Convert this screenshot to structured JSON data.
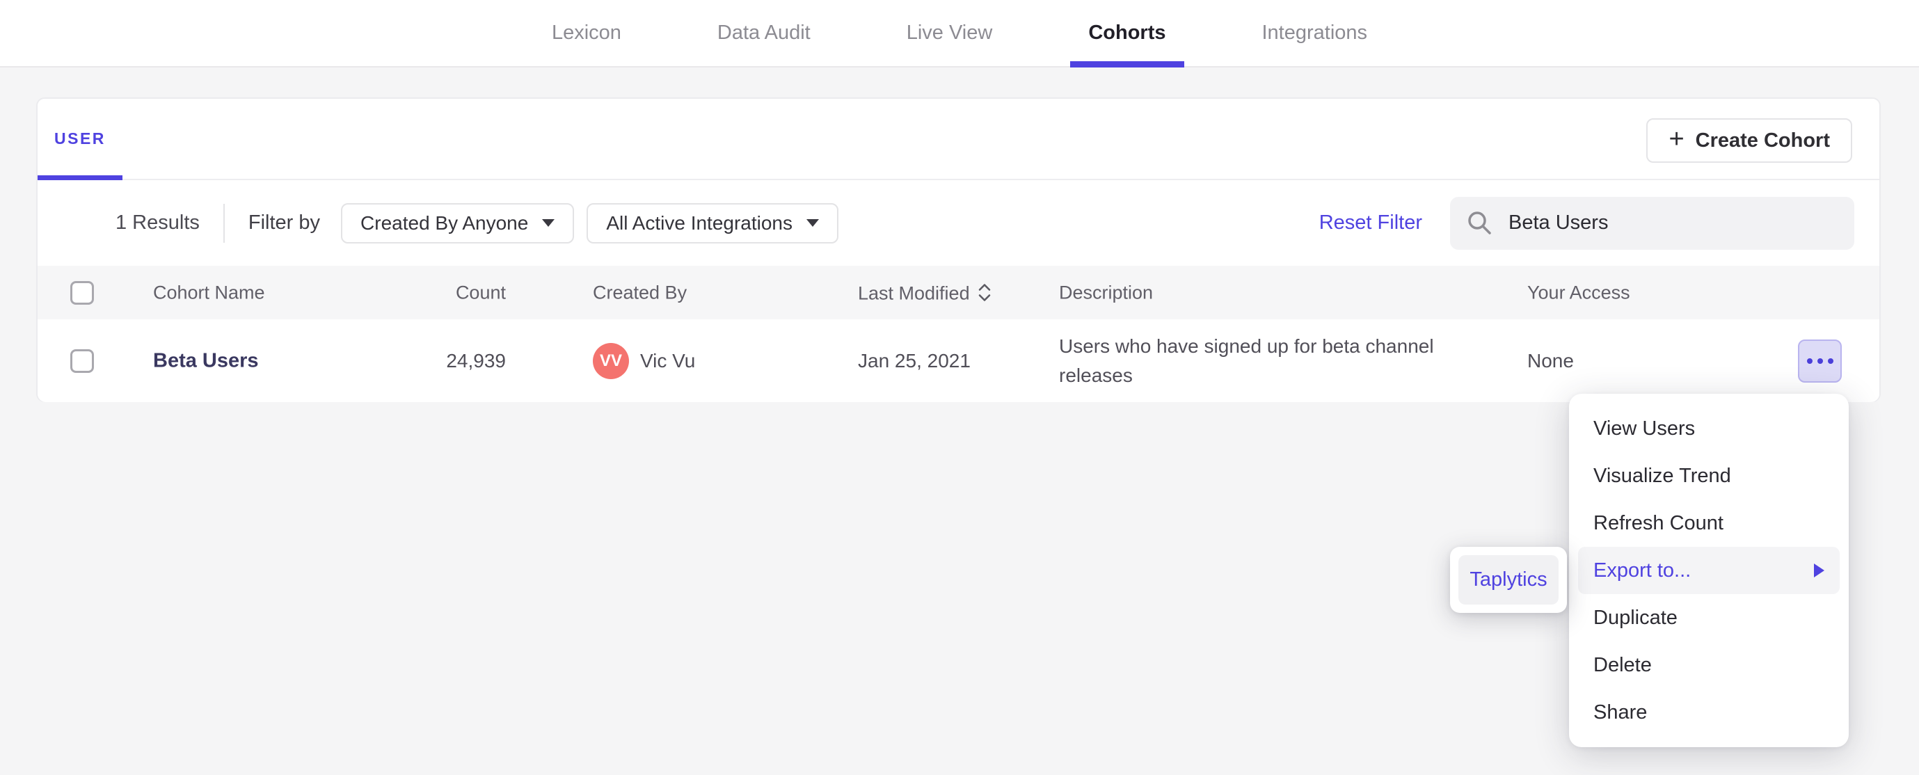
{
  "topnav": {
    "tabs": [
      {
        "label": "Lexicon",
        "active": false
      },
      {
        "label": "Data Audit",
        "active": false
      },
      {
        "label": "Live View",
        "active": false
      },
      {
        "label": "Cohorts",
        "active": true
      },
      {
        "label": "Integrations",
        "active": false
      }
    ]
  },
  "panel": {
    "tab_label": "USER",
    "create_button": {
      "plus": "+",
      "label": "Create Cohort"
    },
    "filters": {
      "results": "1 Results",
      "filter_by": "Filter by",
      "created_by_dropdown": "Created By Anyone",
      "integrations_dropdown": "All Active Integrations",
      "reset": "Reset Filter",
      "search_value": "Beta Users"
    },
    "table": {
      "headers": {
        "name": "Cohort Name",
        "count": "Count",
        "created_by": "Created By",
        "last_modified": "Last Modified",
        "description": "Description",
        "your_access": "Your Access"
      },
      "row": {
        "name": "Beta Users",
        "count": "24,939",
        "avatar_initials": "VV",
        "created_by": "Vic Vu",
        "last_modified": "Jan 25, 2021",
        "description": "Users who have signed up for beta channel releases",
        "your_access": "None"
      }
    }
  },
  "context_menu": {
    "items": [
      "View Users",
      "Visualize Trend",
      "Refresh Count",
      "Export to...",
      "Duplicate",
      "Delete",
      "Share"
    ],
    "active_item": "Export to..."
  },
  "submenu": {
    "items": [
      "Taplytics"
    ]
  },
  "colors": {
    "accent_purple": "#4f42e0",
    "avatar_coral": "#f4736e",
    "page_background": "#f5f5f6",
    "header_row_background": "#f6f6f7"
  }
}
